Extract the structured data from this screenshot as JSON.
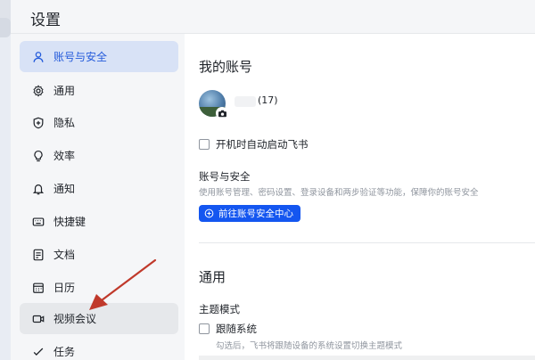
{
  "window": {
    "title": "设置"
  },
  "sidebar": {
    "items": [
      {
        "label": "账号与安全",
        "icon": "user-icon"
      },
      {
        "label": "通用",
        "icon": "gear-icon"
      },
      {
        "label": "隐私",
        "icon": "shield-icon"
      },
      {
        "label": "效率",
        "icon": "lightbulb-icon"
      },
      {
        "label": "通知",
        "icon": "bell-icon"
      },
      {
        "label": "快捷键",
        "icon": "keyboard-icon"
      },
      {
        "label": "文档",
        "icon": "document-icon"
      },
      {
        "label": "日历",
        "icon": "calendar-icon"
      },
      {
        "label": "视频会议",
        "icon": "video-icon"
      },
      {
        "label": "任务",
        "icon": "task-check-icon"
      }
    ]
  },
  "account": {
    "section_title": "我的账号",
    "member_count": "(17)",
    "autostart_label": "开机时自动启动飞书",
    "security_heading": "账号与安全",
    "security_desc": "使用账号管理、密码设置、登录设备和两步验证等功能，保障你的账号安全",
    "security_button": "前往账号安全中心"
  },
  "general": {
    "section_title": "通用",
    "theme_heading": "主题模式",
    "follow_system_label": "跟随系统",
    "follow_system_desc": "勾选后，飞书将跟随设备的系统设置切换主题模式"
  },
  "colors": {
    "accent": "#1456f0",
    "active_item_bg": "#d8e2f6",
    "active_item_text": "#245bdb",
    "annotation_arrow": "#c0392b"
  }
}
